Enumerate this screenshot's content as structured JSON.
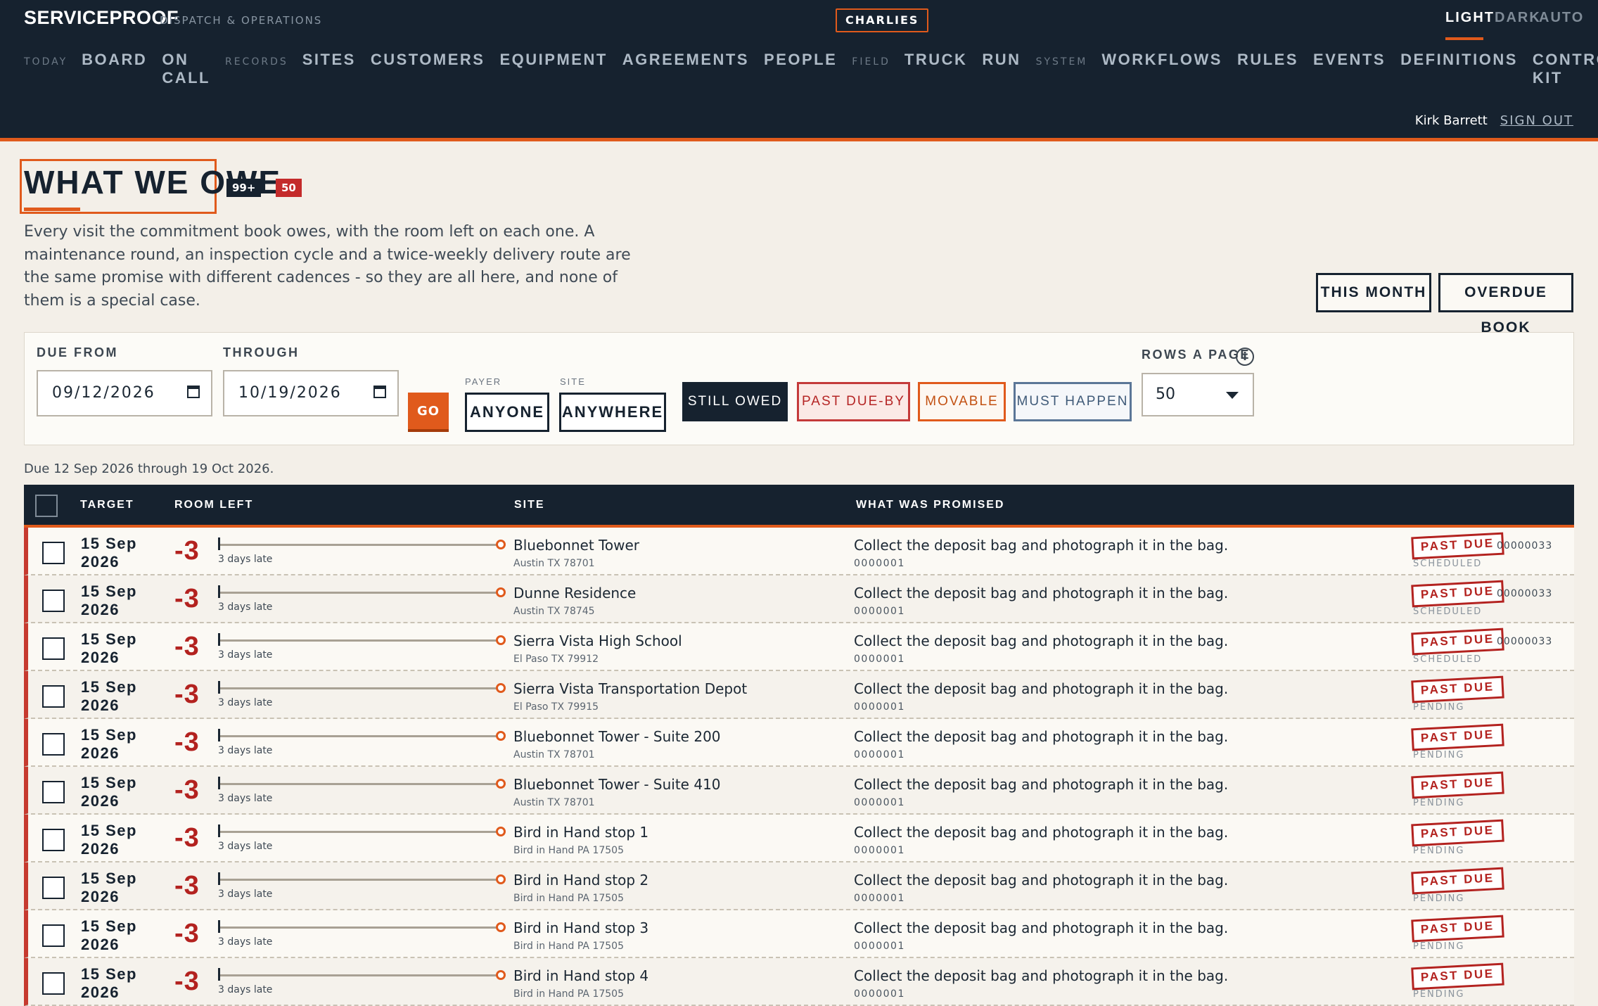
{
  "app": {
    "brand": "SERVICEPROOF",
    "subtitle": "DISPATCH & OPERATIONS",
    "org": "CHARLIES",
    "themes": [
      "LIGHT",
      "DARK",
      "AUTO"
    ],
    "active_theme": "LIGHT"
  },
  "nav": {
    "groups": [
      {
        "label": "TODAY",
        "items": [
          "BOARD",
          "ON CALL"
        ]
      },
      {
        "label": "RECORDS",
        "items": [
          "SITES",
          "CUSTOMERS",
          "EQUIPMENT",
          "AGREEMENTS",
          "PEOPLE"
        ]
      },
      {
        "label": "FIELD",
        "items": [
          "TRUCK",
          "RUN"
        ]
      },
      {
        "label": "SYSTEM",
        "items": [
          "WORKFLOWS",
          "RULES",
          "EVENTS",
          "DEFINITIONS",
          "CONTROL KIT"
        ]
      }
    ],
    "user_name": "Kirk Barrett",
    "sign_out": "SIGN OUT"
  },
  "page": {
    "title": "WHAT WE OWE",
    "badge_total": "99+",
    "badge_overdue": "50",
    "description": "Every visit the commitment book owes, with the room left on each one. A maintenance round, an inspection cycle and a twice-weekly delivery route are the same promise with different cadences - so they are all here, and none of them is a special case.",
    "btn_this_month": "THIS MONTH",
    "btn_overdue_book": "OVERDUE BOOK"
  },
  "filters": {
    "due_from_label": "DUE FROM",
    "due_from_value": "09/12/2026",
    "through_label": "THROUGH",
    "through_value": "10/19/2026",
    "go": "GO",
    "payer_label": "PAYER",
    "payer_value": "ANYONE",
    "site_label": "SITE",
    "site_value": "ANYWHERE",
    "chips": {
      "still_owed": "STILL OWED",
      "past_due_by": "PAST DUE-BY",
      "movable": "MOVABLE",
      "must_happen": "MUST HAPPEN"
    },
    "rows_label": "ROWS A PAGE",
    "rows_value": "50",
    "info_glyph": "i",
    "range_note": "Due 12 Sep 2026 through 19 Oct 2026."
  },
  "table": {
    "headers": {
      "target": "TARGET",
      "room_left": "ROOM LEFT",
      "site": "SITE",
      "promised": "WHAT WAS PROMISED"
    },
    "rows": [
      {
        "date": "15 Sep 2026",
        "room": "-3",
        "late": "3 days late",
        "site": "Bluebonnet Tower",
        "addr": "Austin TX 78701",
        "promise": "Collect the deposit bag and photograph it in the bag.",
        "ref": "0000001",
        "stamp": "PAST DUE",
        "status": "SCHEDULED",
        "serial": "00000033"
      },
      {
        "date": "15 Sep 2026",
        "room": "-3",
        "late": "3 days late",
        "site": "Dunne Residence",
        "addr": "Austin TX 78745",
        "promise": "Collect the deposit bag and photograph it in the bag.",
        "ref": "0000001",
        "stamp": "PAST DUE",
        "status": "SCHEDULED",
        "serial": "00000033"
      },
      {
        "date": "15 Sep 2026",
        "room": "-3",
        "late": "3 days late",
        "site": "Sierra Vista High School",
        "addr": "El Paso TX 79912",
        "promise": "Collect the deposit bag and photograph it in the bag.",
        "ref": "0000001",
        "stamp": "PAST DUE",
        "status": "SCHEDULED",
        "serial": "00000033"
      },
      {
        "date": "15 Sep 2026",
        "room": "-3",
        "late": "3 days late",
        "site": "Sierra Vista Transportation Depot",
        "addr": "El Paso TX 79915",
        "promise": "Collect the deposit bag and photograph it in the bag.",
        "ref": "0000001",
        "stamp": "PAST DUE",
        "status": "PENDING",
        "serial": ""
      },
      {
        "date": "15 Sep 2026",
        "room": "-3",
        "late": "3 days late",
        "site": "Bluebonnet Tower - Suite 200",
        "addr": "Austin TX 78701",
        "promise": "Collect the deposit bag and photograph it in the bag.",
        "ref": "0000001",
        "stamp": "PAST DUE",
        "status": "PENDING",
        "serial": ""
      },
      {
        "date": "15 Sep 2026",
        "room": "-3",
        "late": "3 days late",
        "site": "Bluebonnet Tower - Suite 410",
        "addr": "Austin TX 78701",
        "promise": "Collect the deposit bag and photograph it in the bag.",
        "ref": "0000001",
        "stamp": "PAST DUE",
        "status": "PENDING",
        "serial": ""
      },
      {
        "date": "15 Sep 2026",
        "room": "-3",
        "late": "3 days late",
        "site": "Bird in Hand stop 1",
        "addr": "Bird in Hand PA 17505",
        "promise": "Collect the deposit bag and photograph it in the bag.",
        "ref": "0000001",
        "stamp": "PAST DUE",
        "status": "PENDING",
        "serial": ""
      },
      {
        "date": "15 Sep 2026",
        "room": "-3",
        "late": "3 days late",
        "site": "Bird in Hand stop 2",
        "addr": "Bird in Hand PA 17505",
        "promise": "Collect the deposit bag and photograph it in the bag.",
        "ref": "0000001",
        "stamp": "PAST DUE",
        "status": "PENDING",
        "serial": ""
      },
      {
        "date": "15 Sep 2026",
        "room": "-3",
        "late": "3 days late",
        "site": "Bird in Hand stop 3",
        "addr": "Bird in Hand PA 17505",
        "promise": "Collect the deposit bag and photograph it in the bag.",
        "ref": "0000001",
        "stamp": "PAST DUE",
        "status": "PENDING",
        "serial": ""
      },
      {
        "date": "15 Sep 2026",
        "room": "-3",
        "late": "3 days late",
        "site": "Bird in Hand stop 4",
        "addr": "Bird in Hand PA 17505",
        "promise": "Collect the deposit bag and photograph it in the bag.",
        "ref": "0000001",
        "stamp": "PAST DUE",
        "status": "PENDING",
        "serial": ""
      }
    ]
  }
}
